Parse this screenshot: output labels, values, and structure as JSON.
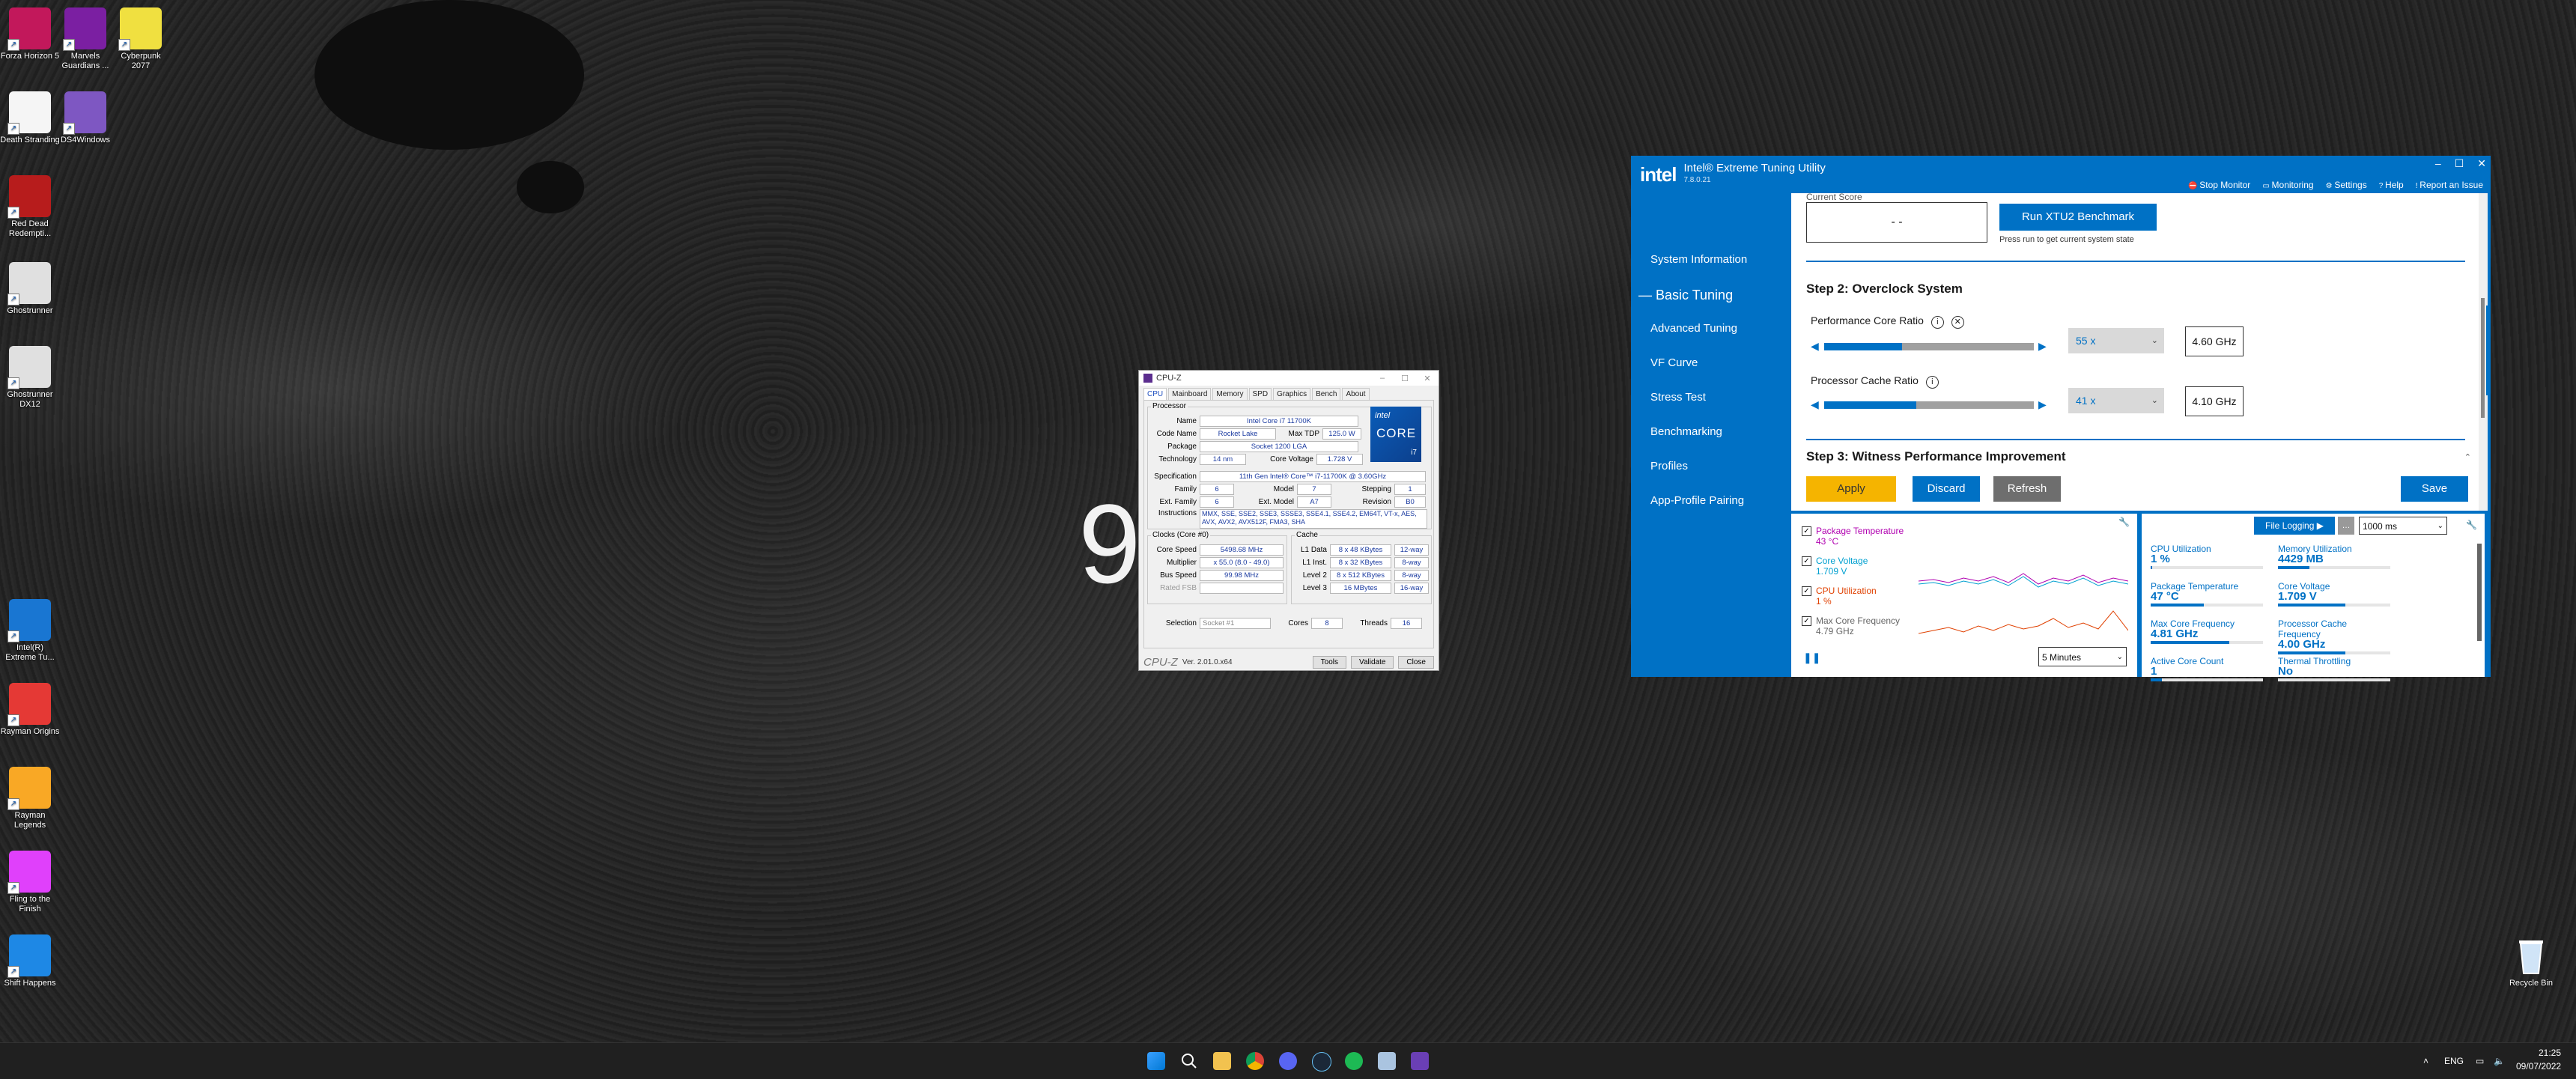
{
  "desktop": {
    "clock_text": "9 M",
    "icons": [
      {
        "label": "Forza Horizon 5",
        "color": "#c2185b"
      },
      {
        "label": "Marvels Guardians ...",
        "color": "#7b1fa2"
      },
      {
        "label": "Cyberpunk 2077",
        "color": "#f0e040"
      },
      {
        "label": "Death Stranding",
        "color": "#f5f5f5"
      },
      {
        "label": "DS4Windows",
        "color": "#7e57c2"
      },
      {
        "label": "Red Dead Redempti...",
        "color": "#b71c1c"
      },
      {
        "label": "Ghostrunner",
        "color": "#e0e0e0"
      },
      {
        "label": "Ghostrunner DX12",
        "color": "#e0e0e0"
      },
      {
        "label": "Intel(R) Extreme Tu...",
        "color": "#1976d2"
      },
      {
        "label": "Rayman Origins",
        "color": "#e53935"
      },
      {
        "label": "Rayman Legends",
        "color": "#f9a825"
      },
      {
        "label": "Fling to the Finish",
        "color": "#e040fb"
      },
      {
        "label": "Shift Happens",
        "color": "#1e88e5"
      }
    ],
    "recycle_bin": "Recycle Bin"
  },
  "cpuz": {
    "title": "CPU-Z",
    "tabs": [
      "CPU",
      "Mainboard",
      "Memory",
      "SPD",
      "Graphics",
      "Bench",
      "About"
    ],
    "processor_group": "Processor",
    "name_label": "Name",
    "name": "Intel Core i7 11700K",
    "codename_label": "Code Name",
    "codename": "Rocket Lake",
    "maxtdp_label": "Max TDP",
    "maxtdp": "125.0 W",
    "package_label": "Package",
    "package": "Socket 1200 LGA",
    "technology_label": "Technology",
    "technology": "14 nm",
    "corevoltage_label": "Core Voltage",
    "corevoltage": "1.728 V",
    "spec_label": "Specification",
    "spec": "11th Gen Intel® Core™ i7-11700K @ 3.60GHz",
    "family_label": "Family",
    "family": "6",
    "model_label": "Model",
    "model": "7",
    "stepping_label": "Stepping",
    "stepping": "1",
    "extfamily_label": "Ext. Family",
    "extfamily": "6",
    "extmodel_label": "Ext. Model",
    "extmodel": "A7",
    "revision_label": "Revision",
    "revision": "B0",
    "instructions_label": "Instructions",
    "instructions": "MMX, SSE, SSE2, SSE3, SSSE3, SSE4.1, SSE4.2, EM64T, VT-x, AES, AVX, AVX2, AVX512F, FMA3, SHA",
    "clocks_group": "Clocks (Core #0)",
    "corespeed_label": "Core Speed",
    "corespeed": "5498.68 MHz",
    "multiplier_label": "Multiplier",
    "multiplier": "x 55.0 (8.0 - 49.0)",
    "busspeed_label": "Bus Speed",
    "busspeed": "99.98 MHz",
    "ratedfsb_label": "Rated FSB",
    "cache_group": "Cache",
    "l1data_label": "L1 Data",
    "l1data": "8 x 48 KBytes",
    "l1data_way": "12-way",
    "l1inst_label": "L1 Inst.",
    "l1inst": "8 x 32 KBytes",
    "l1inst_way": "8-way",
    "l2_label": "Level 2",
    "l2": "8 x 512 KBytes",
    "l2_way": "8-way",
    "l3_label": "Level 3",
    "l3": "16 MBytes",
    "l3_way": "16-way",
    "selection_label": "Selection",
    "selection": "Socket #1",
    "cores_label": "Cores",
    "cores": "8",
    "threads_label": "Threads",
    "threads": "16",
    "brand": "CPU-Z",
    "version": "Ver. 2.01.0.x64",
    "tools": "Tools",
    "validate": "Validate",
    "close": "Close",
    "logo_top": "intel",
    "logo_main": "CORE",
    "logo_sub": "i7"
  },
  "xtu": {
    "logo": "intel",
    "title": "Intel® Extreme Tuning Utility",
    "version": "7.8.0.21",
    "header_links": [
      "Stop Monitor",
      "Monitoring",
      "Settings",
      "Help",
      "Report an Issue"
    ],
    "nav": [
      "System Information",
      "Basic Tuning",
      "Advanced Tuning",
      "VF Curve",
      "Stress Test",
      "Benchmarking",
      "Profiles",
      "App-Profile Pairing"
    ],
    "current_score_label": "Current Score",
    "score_value": "- -",
    "run_benchmark": "Run XTU2 Benchmark",
    "press_run_hint": "Press run to get current system state",
    "step2_title": "Step 2: Overclock System",
    "perf_core_ratio_label": "Performance Core Ratio",
    "perf_core_ratio_value": "55 x",
    "perf_core_freq": "4.60 GHz",
    "perf_core_fill_pct": 0.37,
    "cache_ratio_label": "Processor Cache Ratio",
    "cache_ratio_value": "41 x",
    "cache_freq": "4.10 GHz",
    "cache_fill_pct": 0.44,
    "step3_title": "Step 3: Witness Performance Improvement",
    "apply": "Apply",
    "discard": "Discard",
    "refresh": "Refresh",
    "save": "Save",
    "monitor": {
      "pkg_temp_label": "Package Temperature",
      "pkg_temp": "43 °C",
      "core_voltage_label": "Core Voltage",
      "core_voltage": "1.709 V",
      "cpu_util_label": "CPU Utilization",
      "cpu_util": "1 %",
      "max_core_freq_label": "Max Core Frequency",
      "max_core_freq": "4.79 GHz",
      "duration": "5 Minutes",
      "file_logging": "File Logging",
      "interval": "1000 ms",
      "tiles": [
        {
          "label": "CPU Utilization",
          "value": "1 %",
          "level": 0.01
        },
        {
          "label": "Memory Utilization",
          "value": "4429 MB",
          "level": 0.28
        },
        {
          "label": "Package Temperature",
          "value": "47 °C",
          "level": 0.47
        },
        {
          "label": "Core Voltage",
          "value": "1.709 V",
          "level": 0.6
        },
        {
          "label": "Max Core Frequency",
          "value": "4.81 GHz",
          "level": 0.7
        },
        {
          "label": "Processor Cache Frequency",
          "value": "4.00 GHz",
          "level": 0.6
        },
        {
          "label": "Active Core Count",
          "value": "1",
          "level": 0.1
        },
        {
          "label": "Thermal Throttling",
          "value": "No",
          "level": 0.0
        }
      ]
    }
  },
  "taskbar": {
    "lang": "ENG",
    "time": "21:25",
    "date": "09/07/2022"
  }
}
